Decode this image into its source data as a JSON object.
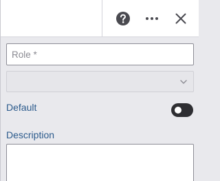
{
  "header": {
    "help_icon": "help-circle-icon",
    "more_icon": "more-horizontal-icon",
    "close_icon": "close-icon"
  },
  "form": {
    "role": {
      "placeholder": "Role *",
      "value": ""
    },
    "select": {
      "value": "",
      "icon": "chevron-down-icon"
    },
    "default": {
      "label": "Default",
      "toggle_on": false
    },
    "description": {
      "label": "Description",
      "value": ""
    }
  },
  "colors": {
    "label_text": "#2b5a8c",
    "panel_background": "#e9e9ed",
    "toggle_track": "#2e2e32",
    "icon": "#4a4a50"
  }
}
